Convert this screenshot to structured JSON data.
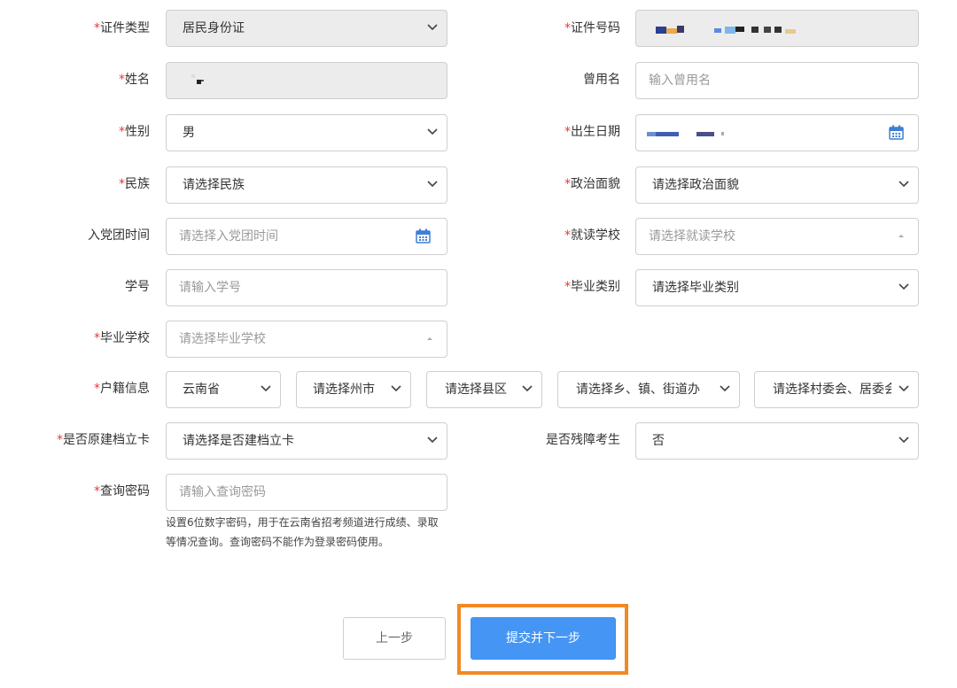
{
  "form": {
    "id_type": {
      "label": "证件类型",
      "required": true,
      "value": "居民身份证"
    },
    "id_number": {
      "label": "证件号码",
      "required": true
    },
    "name": {
      "label": "姓名",
      "required": true
    },
    "former_name": {
      "label": "曾用名",
      "required": false,
      "placeholder": "输入曾用名"
    },
    "gender": {
      "label": "性别",
      "required": true,
      "value": "男"
    },
    "birth_date": {
      "label": "出生日期",
      "required": true
    },
    "ethnicity": {
      "label": "民族",
      "required": true,
      "value": "请选择民族"
    },
    "political_status": {
      "label": "政治面貌",
      "required": true,
      "value": "请选择政治面貌"
    },
    "party_join_time": {
      "label": "入党团时间",
      "required": false,
      "placeholder": "请选择入党团时间"
    },
    "school": {
      "label": "就读学校",
      "required": true,
      "placeholder": "请选择就读学校"
    },
    "student_no": {
      "label": "学号",
      "required": false,
      "placeholder": "请输入学号"
    },
    "graduation_type": {
      "label": "毕业类别",
      "required": true,
      "value": "请选择毕业类别"
    },
    "graduation_school": {
      "label": "毕业学校",
      "required": true,
      "placeholder": "请选择毕业学校"
    },
    "household": {
      "label": "户籍信息",
      "required": true,
      "province": "云南省",
      "city": "请选择州市",
      "county": "请选择县区",
      "town": "请选择乡、镇、街道办",
      "village": "请选择村委会、居委会"
    },
    "archive_card": {
      "label": "是否原建档立卡",
      "required": true,
      "value": "请选择是否建档立卡"
    },
    "disabled_candidate": {
      "label": "是否残障考生",
      "required": false,
      "value": "否"
    },
    "query_password": {
      "label": "查询密码",
      "required": true,
      "placeholder": "请输入查询密码",
      "help": "设置6位数字密码，用于在云南省招考频道进行成绩、录取等情况查询。查询密码不能作为登录密码使用。"
    }
  },
  "buttons": {
    "prev": "上一步",
    "next": "提交并下一步"
  },
  "colors": {
    "required": "#e4393c",
    "primary": "#4596f4",
    "highlight": "#f08a24",
    "calendar": "#3d7fd6"
  }
}
